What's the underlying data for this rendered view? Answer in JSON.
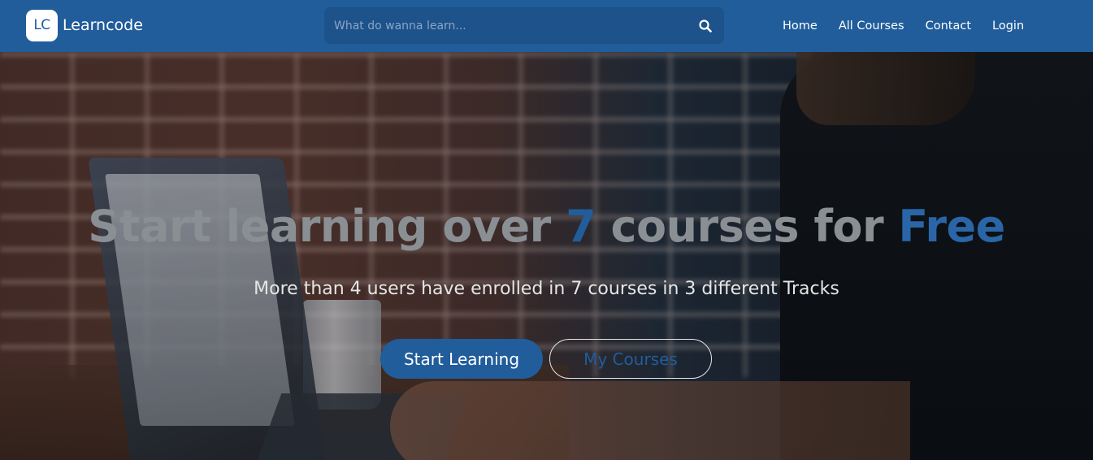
{
  "navbar": {
    "logo_text": "LC",
    "brand_name": "Learncode",
    "search": {
      "placeholder": "What do wanna learn..."
    },
    "links": [
      {
        "label": "Home"
      },
      {
        "label": "All Courses"
      },
      {
        "label": "Contact"
      },
      {
        "label": "Login"
      }
    ]
  },
  "hero": {
    "headline": {
      "part1": "Start learning over ",
      "count": "7",
      "part2": " courses for ",
      "free": "Free"
    },
    "subline": "More than 4 users have enrolled in 7 courses in 3 different Tracks",
    "primary_button": "Start Learning",
    "secondary_button": "My Courses"
  },
  "colors": {
    "brand_blue": "#215d9b",
    "search_bg": "#1d528a"
  },
  "icons": {
    "search": "search-icon"
  }
}
